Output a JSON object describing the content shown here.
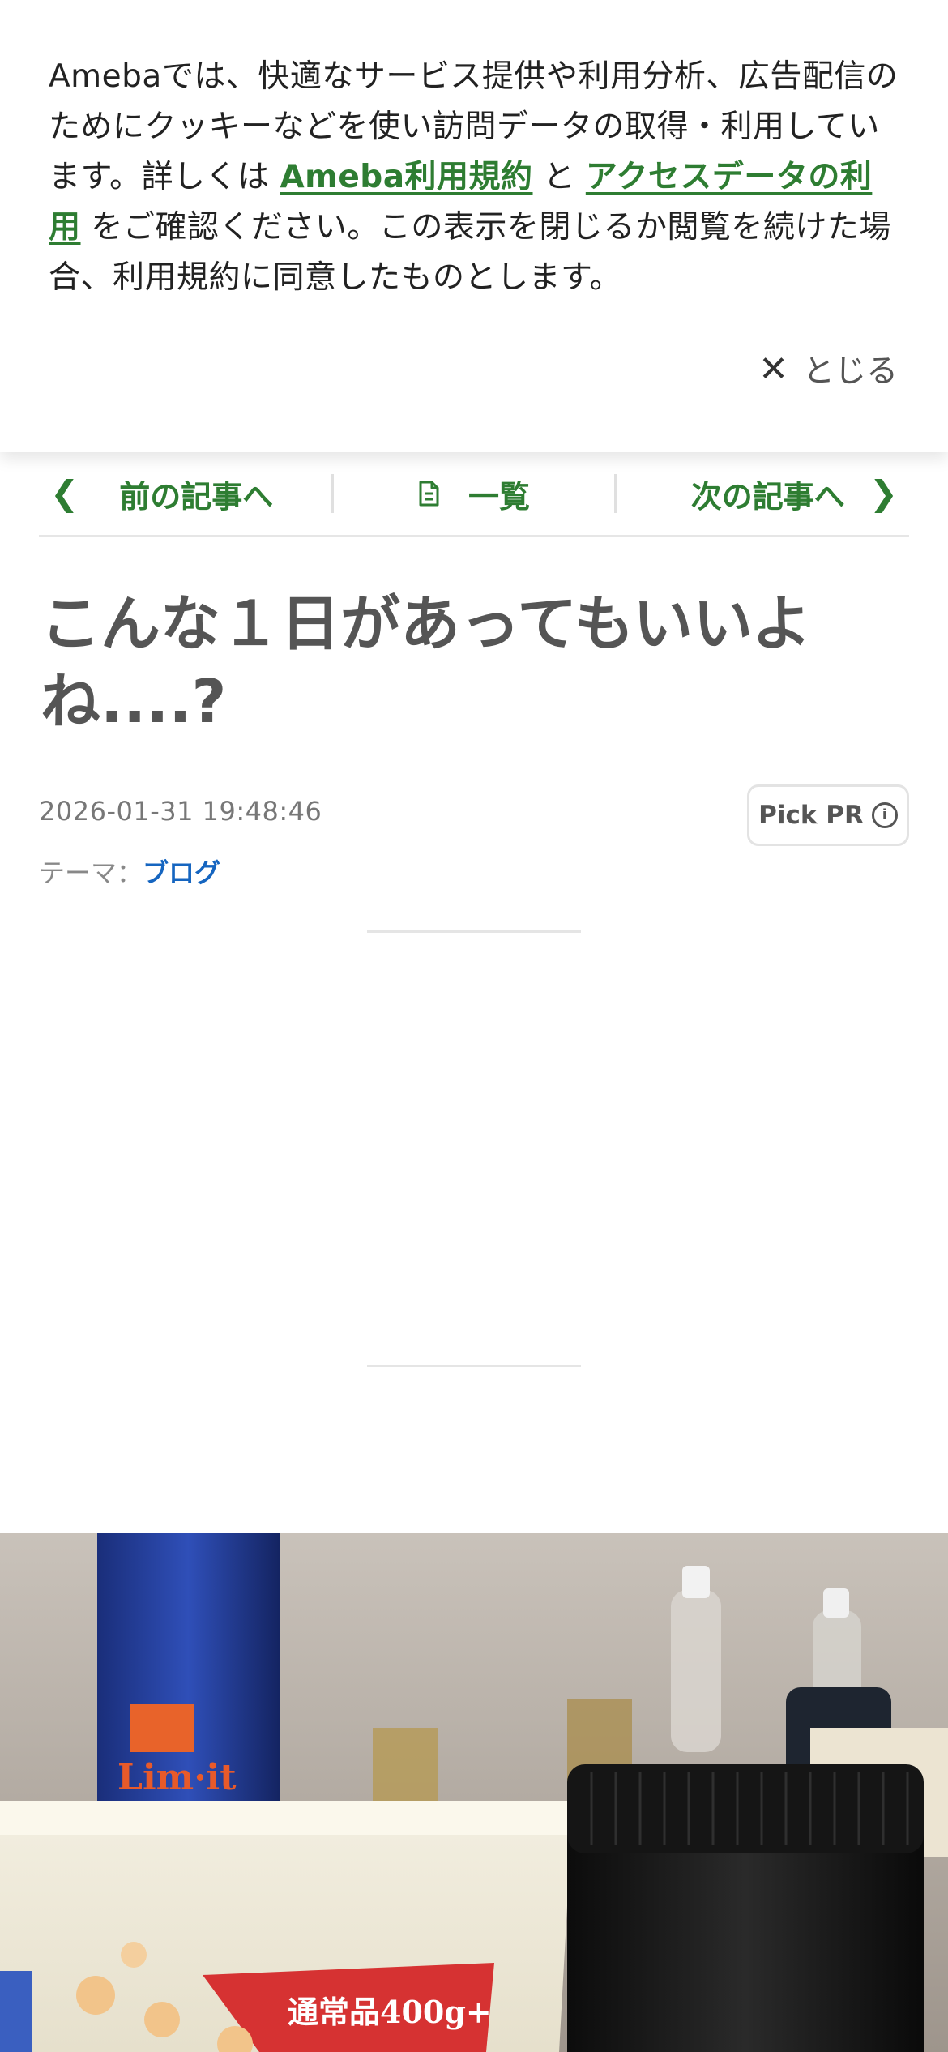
{
  "cookie_banner": {
    "text_prefix": "Amebaでは、快適なサービス提供や利用分析、広告配信のためにクッキーなどを使い訪問データの取得・利用しています。詳しくは ",
    "link_terms": "Ameba利用規約",
    "conjunction": " と ",
    "link_access_data": "アクセスデータの利用",
    "text_suffix": " をご確認ください。この表示を閉じるか閲覧を続けた場合、利用規約に同意したものとします。",
    "close_label": "とじる"
  },
  "pager": {
    "prev_label": "前の記事へ",
    "list_label": "一覧",
    "next_label": "次の記事へ"
  },
  "article": {
    "title": "こんな１日があってもいいよね....?",
    "date": "2026-01-31 19:48:46",
    "theme_label": "テーマ：",
    "theme_value": "ブログ",
    "pick_pr_label": "Pick PR"
  },
  "photo": {
    "tub_label": "通常品400g+",
    "bottle_label": "Lim·it"
  },
  "colors": {
    "accent_green": "#2e7d32",
    "link_blue": "#1565c0"
  },
  "icons": [
    "close-icon",
    "chevron-left-icon",
    "document-icon",
    "chevron-right-icon",
    "info-icon"
  ]
}
